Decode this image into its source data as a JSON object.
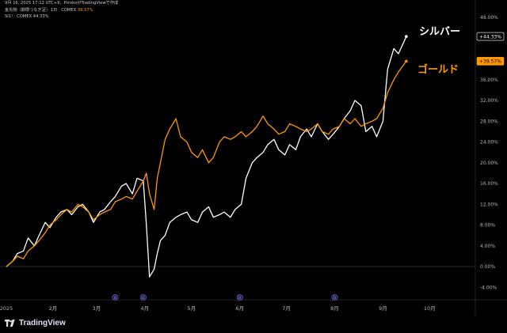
{
  "header": {
    "line1": "9月 16, 2025 17:12 UTC+9、HirokoがTradingViewで作成",
    "line2_prefix": "金先物（期限つなぎ足）· 1日 · COMEX",
    "line2_value": "39.57%",
    "line3": "SI1! · COMEX  44.33%"
  },
  "branding": {
    "logo_text": "TradingView",
    "logo_icon": "tradingview-logo-icon"
  },
  "colors": {
    "silver": "#ffffff",
    "gold": "#ff9800",
    "background": "#000000",
    "axis_text": "#b2b5be",
    "grid": "#1e222d"
  },
  "chart_data": {
    "type": "line",
    "title": "",
    "ylabel": "",
    "xlabel": "",
    "y_unit": "%",
    "ylim": [
      -5.5,
      50
    ],
    "xlim": [
      "2025-01-02",
      "2025-10-31"
    ],
    "y_ticks": [
      "48.00%",
      "44.00%",
      "40.00%",
      "36.00%",
      "32.00%",
      "28.00%",
      "24.00%",
      "20.00%",
      "16.00%",
      "12.00%",
      "8.00%",
      "4.00%",
      "0.00%",
      "-4.00%"
    ],
    "y_tick_values": [
      48,
      44,
      40,
      36,
      32,
      28,
      24,
      20,
      16,
      12,
      8,
      4,
      0,
      -4
    ],
    "x_ticks": [
      {
        "label": "2025",
        "date": "2025-01-01"
      },
      {
        "label": "2月",
        "date": "2025-02-01"
      },
      {
        "label": "3月",
        "date": "2025-03-01"
      },
      {
        "label": "4月",
        "date": "2025-04-01"
      },
      {
        "label": "5月",
        "date": "2025-05-01"
      },
      {
        "label": "6月",
        "date": "2025-06-01"
      },
      {
        "label": "7月",
        "date": "2025-07-01"
      },
      {
        "label": "8月",
        "date": "2025-08-01"
      },
      {
        "label": "9月",
        "date": "2025-09-01"
      },
      {
        "label": "10月",
        "date": "2025-10-01"
      }
    ],
    "event_markers": [
      {
        "label": "D",
        "date": "2025-03-13"
      },
      {
        "label": "D",
        "date": "2025-03-31"
      },
      {
        "label": "D",
        "date": "2025-06-01"
      },
      {
        "label": "D",
        "date": "2025-08-01"
      }
    ],
    "series": [
      {
        "name": "シルバー",
        "color": "#ffffff",
        "last_label": "+44.33%",
        "dates": [
          "2025-01-02",
          "2025-01-06",
          "2025-01-09",
          "2025-01-13",
          "2025-01-16",
          "2025-01-20",
          "2025-01-23",
          "2025-01-27",
          "2025-01-30",
          "2025-02-03",
          "2025-02-06",
          "2025-02-10",
          "2025-02-13",
          "2025-02-17",
          "2025-02-20",
          "2025-02-24",
          "2025-02-27",
          "2025-03-03",
          "2025-03-06",
          "2025-03-10",
          "2025-03-13",
          "2025-03-17",
          "2025-03-20",
          "2025-03-24",
          "2025-03-27",
          "2025-03-31",
          "2025-04-02",
          "2025-04-04",
          "2025-04-07",
          "2025-04-09",
          "2025-04-11",
          "2025-04-14",
          "2025-04-17",
          "2025-04-21",
          "2025-04-24",
          "2025-04-28",
          "2025-05-01",
          "2025-05-05",
          "2025-05-08",
          "2025-05-12",
          "2025-05-15",
          "2025-05-19",
          "2025-05-22",
          "2025-05-26",
          "2025-05-29",
          "2025-06-02",
          "2025-06-05",
          "2025-06-09",
          "2025-06-12",
          "2025-06-16",
          "2025-06-19",
          "2025-06-23",
          "2025-06-26",
          "2025-06-30",
          "2025-07-03",
          "2025-07-07",
          "2025-07-10",
          "2025-07-14",
          "2025-07-17",
          "2025-07-21",
          "2025-07-24",
          "2025-07-28",
          "2025-07-31",
          "2025-08-04",
          "2025-08-07",
          "2025-08-11",
          "2025-08-14",
          "2025-08-18",
          "2025-08-21",
          "2025-08-25",
          "2025-08-28",
          "2025-09-01",
          "2025-09-04",
          "2025-09-08",
          "2025-09-11",
          "2025-09-16"
        ],
        "values": [
          0.0,
          1.0,
          2.5,
          3.0,
          5.5,
          4.0,
          6.0,
          8.5,
          7.5,
          9.5,
          10.5,
          11.0,
          10.0,
          11.5,
          12.0,
          10.5,
          8.5,
          10.5,
          11.0,
          12.5,
          13.5,
          15.5,
          16.0,
          14.0,
          17.0,
          16.5,
          8.0,
          -2.0,
          -0.5,
          2.5,
          5.0,
          6.0,
          8.5,
          9.5,
          10.0,
          10.5,
          9.0,
          8.5,
          10.5,
          11.5,
          9.5,
          10.0,
          10.5,
          9.5,
          11.0,
          12.0,
          17.0,
          20.0,
          21.0,
          22.0,
          23.5,
          24.5,
          22.5,
          21.5,
          23.5,
          22.5,
          25.0,
          26.5,
          25.0,
          27.5,
          26.0,
          24.5,
          25.5,
          27.0,
          28.5,
          30.0,
          32.0,
          31.0,
          26.0,
          27.0,
          25.0,
          28.0,
          38.0,
          42.0,
          41.0,
          44.33
        ]
      },
      {
        "name": "ゴールド",
        "color": "#ff9800",
        "last_label": "+39.57%",
        "dates": [
          "2025-01-02",
          "2025-01-06",
          "2025-01-09",
          "2025-01-13",
          "2025-01-16",
          "2025-01-20",
          "2025-01-23",
          "2025-01-27",
          "2025-01-30",
          "2025-02-03",
          "2025-02-06",
          "2025-02-10",
          "2025-02-13",
          "2025-02-17",
          "2025-02-20",
          "2025-02-24",
          "2025-02-27",
          "2025-03-03",
          "2025-03-06",
          "2025-03-10",
          "2025-03-13",
          "2025-03-17",
          "2025-03-20",
          "2025-03-24",
          "2025-03-27",
          "2025-03-31",
          "2025-04-02",
          "2025-04-04",
          "2025-04-07",
          "2025-04-09",
          "2025-04-11",
          "2025-04-14",
          "2025-04-17",
          "2025-04-21",
          "2025-04-24",
          "2025-04-28",
          "2025-05-01",
          "2025-05-05",
          "2025-05-08",
          "2025-05-12",
          "2025-05-15",
          "2025-05-19",
          "2025-05-22",
          "2025-05-26",
          "2025-05-29",
          "2025-06-02",
          "2025-06-05",
          "2025-06-09",
          "2025-06-12",
          "2025-06-16",
          "2025-06-19",
          "2025-06-23",
          "2025-06-26",
          "2025-06-30",
          "2025-07-03",
          "2025-07-07",
          "2025-07-10",
          "2025-07-14",
          "2025-07-17",
          "2025-07-21",
          "2025-07-24",
          "2025-07-28",
          "2025-07-31",
          "2025-08-04",
          "2025-08-07",
          "2025-08-11",
          "2025-08-14",
          "2025-08-18",
          "2025-08-21",
          "2025-08-25",
          "2025-08-28",
          "2025-09-01",
          "2025-09-04",
          "2025-09-08",
          "2025-09-11",
          "2025-09-16"
        ],
        "values": [
          0.0,
          1.0,
          2.0,
          1.5,
          3.0,
          4.0,
          5.0,
          6.5,
          8.0,
          9.0,
          10.0,
          11.0,
          10.5,
          12.0,
          11.5,
          10.5,
          9.0,
          10.0,
          10.5,
          11.0,
          12.5,
          13.0,
          13.5,
          13.0,
          14.5,
          16.5,
          18.0,
          14.0,
          11.0,
          17.0,
          20.0,
          24.5,
          26.5,
          28.5,
          25.0,
          24.0,
          22.0,
          21.0,
          22.5,
          20.0,
          21.0,
          24.0,
          25.0,
          24.5,
          25.0,
          26.0,
          25.0,
          26.0,
          27.0,
          29.0,
          27.5,
          26.5,
          25.5,
          26.0,
          27.5,
          27.0,
          26.5,
          26.0,
          26.5,
          27.5,
          26.0,
          25.5,
          26.5,
          27.0,
          28.5,
          27.5,
          28.5,
          27.0,
          27.5,
          28.0,
          28.5,
          30.5,
          33.5,
          36.0,
          37.5,
          39.57
        ]
      }
    ]
  }
}
